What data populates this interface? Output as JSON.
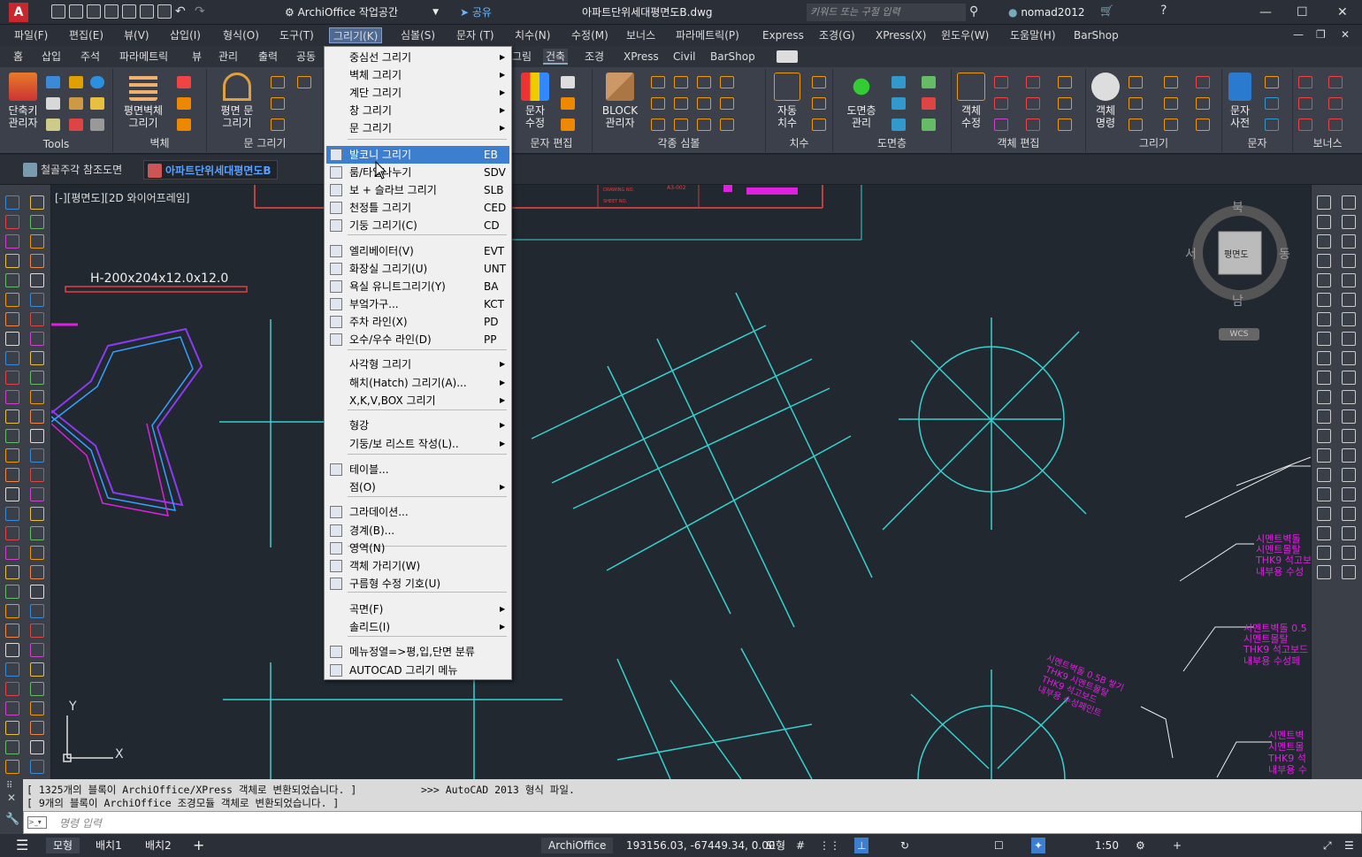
{
  "window": {
    "app_button": "A",
    "workspace": "ArchiOffice 작업공간",
    "share": "공유",
    "title": "아파트단위세대평면도B.dwg",
    "search_placeholder": "키워드 또는 구절 입력",
    "user": "nomad2012"
  },
  "menubar": [
    "파일(F)",
    "편집(E)",
    "뷰(V)",
    "삽입(I)",
    "형식(O)",
    "도구(T)",
    "그리기(K)",
    "심볼(S)",
    "문자 (T)",
    "치수(N)",
    "수정(M)",
    "보너스",
    "파라메트릭(P)",
    "Express",
    "조경(G)",
    "XPress(X)",
    "윈도우(W)",
    "도움말(H)",
    "BarShop"
  ],
  "ribbon_tabs": [
    "홈",
    "삽입",
    "주석",
    "파라메트릭",
    "뷰",
    "관리",
    "출력",
    "공동",
    "그림",
    "건축",
    "조경",
    "XPress",
    "Civil",
    "BarShop"
  ],
  "ribbon_panels": {
    "tools": {
      "label": "Tools",
      "btn": "단축키\n관리자"
    },
    "wall": {
      "label": "벽체",
      "btn": "평면벽체\n그리기"
    },
    "door": {
      "label": "문 그리기",
      "btn": "평면 문\n그리기"
    },
    "text_edit": {
      "label": "문자 편집",
      "btn": "문자\n수정"
    },
    "symbols": {
      "label": "각종 심볼",
      "btn": "BLOCK\n관리자"
    },
    "dim": {
      "label": "치수",
      "btn": "자동\n치수"
    },
    "layers": {
      "label": "도면층",
      "btn": "도면층\n관리"
    },
    "obj_edit": {
      "label": "객체 편집",
      "btn": "객체\n수정"
    },
    "draw": {
      "label": "그리기",
      "btn": "객체\n명령"
    },
    "text": {
      "label": "문자",
      "btn": "문자\n사전"
    },
    "bonus": {
      "label": "보너스"
    }
  },
  "file_tabs": [
    "철골주각 참조도면",
    "아파트단위세대평면도B"
  ],
  "viewport_label": "[-][평면도][2D 와이어프레임]",
  "viewcube": {
    "north": "북",
    "south": "남",
    "east": "동",
    "west": "서",
    "face": "평면도",
    "wcs": "WCS"
  },
  "canvas_text": {
    "beam_label": "H-200x204x12.0x12.0",
    "notes_1": [
      "시멘트벽돌",
      "시멘트몰탈",
      "THK9 석고보",
      "내부용 수성"
    ],
    "notes_2": [
      "시멘트벽돌 0.5",
      "시멘트몰탈",
      "THK9 석고보드",
      "내부용 수성페"
    ],
    "notes_3": [
      "시멘트벽돌 0.5B 쌓기",
      "THK9 시멘트몰탈",
      "THK9 석고보드",
      "내부용 수성페인트"
    ],
    "notes_4": [
      "시멘트벽",
      "시멘트몰",
      "THK9 석",
      "내부용 수"
    ],
    "title_block": [
      "DRAWING NO.",
      "SHEET NO.",
      "A3-002"
    ]
  },
  "draw_menu": {
    "items": [
      {
        "label": "중심선 그리기",
        "short": "",
        "sub": true
      },
      {
        "label": "벽체 그리기",
        "short": "",
        "sub": true
      },
      {
        "label": "계단 그리기",
        "short": "",
        "sub": true
      },
      {
        "label": "창 그리기",
        "short": "",
        "sub": true
      },
      {
        "label": "문 그리기",
        "short": "",
        "sub": true
      },
      {
        "label": "발코니 그리기",
        "short": "EB",
        "sub": false,
        "highlight": true
      },
      {
        "label": "룸/타일나누기",
        "short": "SDV",
        "sub": false
      },
      {
        "label": "보 + 슬라브 그리기",
        "short": "SLB",
        "sub": false
      },
      {
        "label": "천정틀 그리기",
        "short": "CED",
        "sub": false
      },
      {
        "label": "기둥 그리기(C)",
        "short": "CD",
        "sub": false
      },
      {
        "label": "엘리베이터(V)",
        "short": "EVT",
        "sub": false
      },
      {
        "label": "화장실 그리기(U)",
        "short": "UNT",
        "sub": false
      },
      {
        "label": "욕실 유니트그리기(Y)",
        "short": "BA",
        "sub": false
      },
      {
        "label": "부엌가구...",
        "short": "KCT",
        "sub": false
      },
      {
        "label": "주차 라인(X)",
        "short": "PD",
        "sub": false
      },
      {
        "label": "오수/우수 라인(D)",
        "short": "PP",
        "sub": false
      },
      {
        "label": "사각형 그리기",
        "short": "",
        "sub": true
      },
      {
        "label": "해치(Hatch) 그리기(A)...",
        "short": "",
        "sub": true
      },
      {
        "label": "X,K,V,BOX 그리기",
        "short": "",
        "sub": true
      },
      {
        "label": "형강",
        "short": "",
        "sub": true
      },
      {
        "label": "기둥/보 리스트 작성(L)..",
        "short": "",
        "sub": true
      },
      {
        "label": "테이블...",
        "short": "",
        "sub": false
      },
      {
        "label": "점(O)",
        "short": "",
        "sub": true
      },
      {
        "label": "그라데이션...",
        "short": "",
        "sub": false
      },
      {
        "label": "경계(B)...",
        "short": "",
        "sub": false
      },
      {
        "label": "영역(N)",
        "short": "",
        "sub": false
      },
      {
        "label": "객체 가리기(W)",
        "short": "",
        "sub": false
      },
      {
        "label": "구름형 수정 기호(U)",
        "short": "",
        "sub": false
      },
      {
        "label": "곡면(F)",
        "short": "",
        "sub": true
      },
      {
        "label": "솔리드(I)",
        "short": "",
        "sub": true
      },
      {
        "label": "메뉴정열=>평,입,단면 분류",
        "short": "",
        "sub": false
      },
      {
        "label": "AUTOCAD 그리기 메뉴",
        "short": "",
        "sub": false
      }
    ]
  },
  "command": {
    "history_1": "[ 1325개의 블록이 ArchiOffice/XPress 객체로 변환되었습니다. ]",
    "history_2": "[ 9개의 블록이 ArchiOffice 조경모듈 객체로 변환되었습니다. ]",
    "message": ">>> AutoCAD 2013 형식 파일.",
    "prompt": "명령 입력"
  },
  "status": {
    "tabs": [
      "모형",
      "배치1",
      "배치2"
    ],
    "app": "ArchiOffice",
    "coords": "193156.03, -67449.34, 0.00",
    "space": "모형",
    "scale": "1:50"
  },
  "colors": {
    "cyan": "#36d1d1",
    "magenta": "#e020e0",
    "purple": "#8a3cf0",
    "red": "#d04040",
    "highlight": "#3c7fd1"
  }
}
